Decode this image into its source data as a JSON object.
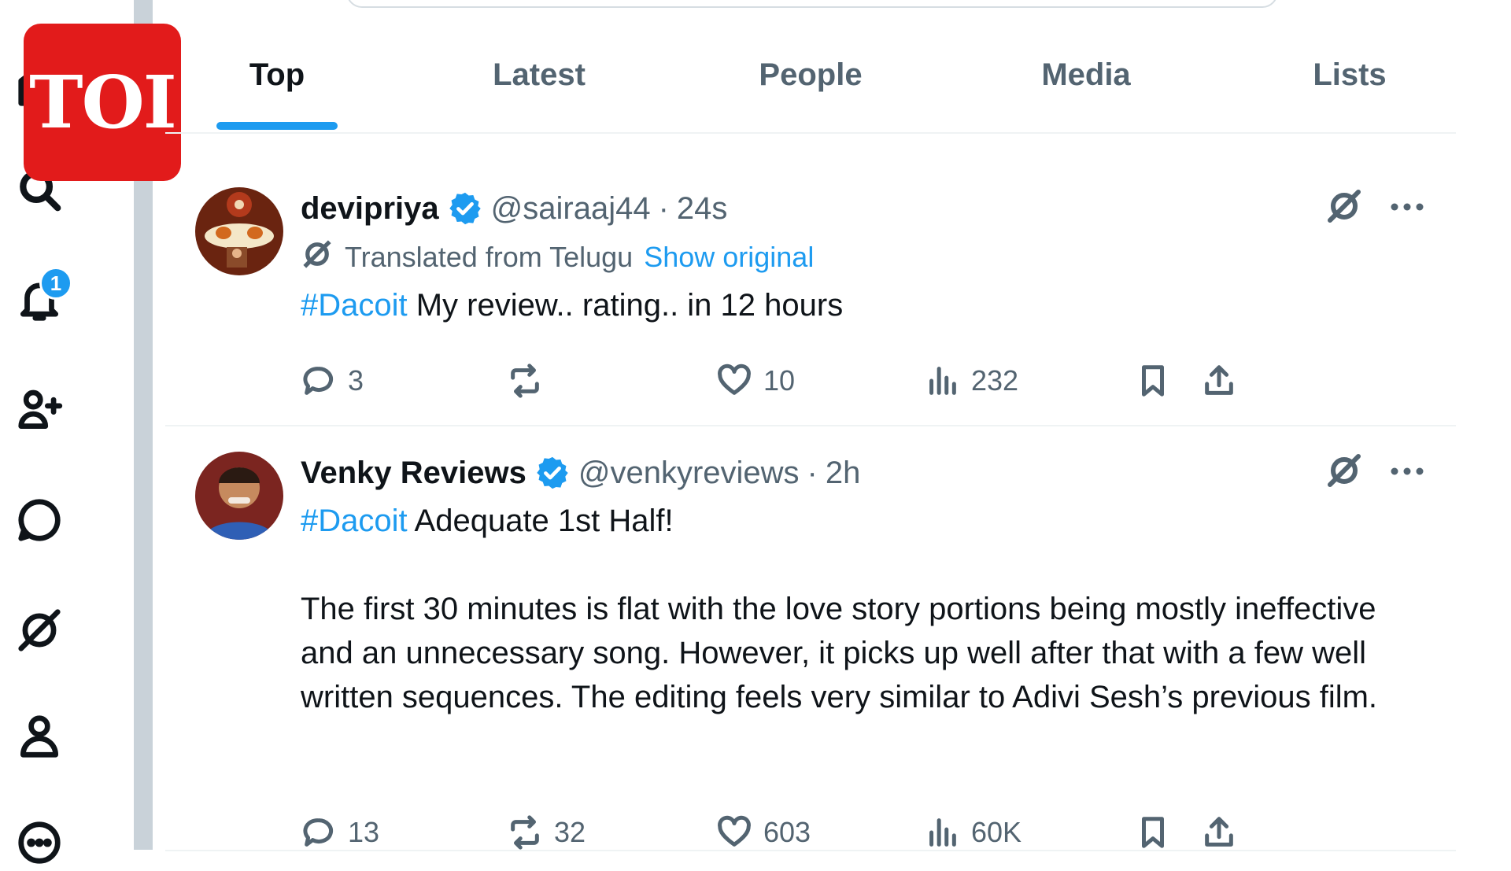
{
  "logo": {
    "text": "TOI",
    "color": "#e21b1b"
  },
  "nav": {
    "icons": [
      "home-icon",
      "search-icon",
      "notifications-icon",
      "follow-icon",
      "messages-icon",
      "grok-icon",
      "profile-icon",
      "more-icon"
    ],
    "notification_count": "1"
  },
  "tabs": [
    {
      "label": "Top",
      "active": true
    },
    {
      "label": "Latest",
      "active": false
    },
    {
      "label": "People",
      "active": false
    },
    {
      "label": "Media",
      "active": false
    },
    {
      "label": "Lists",
      "active": false
    }
  ],
  "accent_color": "#1d9bf0",
  "tweets": [
    {
      "name": "devipriya",
      "handle": "@sairaaj44",
      "separator": "·",
      "time": "24s",
      "translated_label": "Translated from Telugu",
      "show_original": "Show original",
      "hashtag": "#Dacoit",
      "text": " My review.. rating.. in 12 hours",
      "replies": "3",
      "reposts": "",
      "likes": "10",
      "views": "232"
    },
    {
      "name": "Venky Reviews",
      "handle": "@venkyreviews",
      "separator": "·",
      "time": "2h",
      "hashtag": "#Dacoit",
      "text_line1": " Adequate 1st Half!",
      "text_body": "The first 30 minutes is flat with the love story portions being mostly ineffective and an unnecessary song. However, it picks up well after that with a few well written sequences. The editing feels very similar to Adivi Sesh’s previous film.",
      "replies": "13",
      "reposts": "32",
      "likes": "603",
      "views": "60K"
    }
  ]
}
